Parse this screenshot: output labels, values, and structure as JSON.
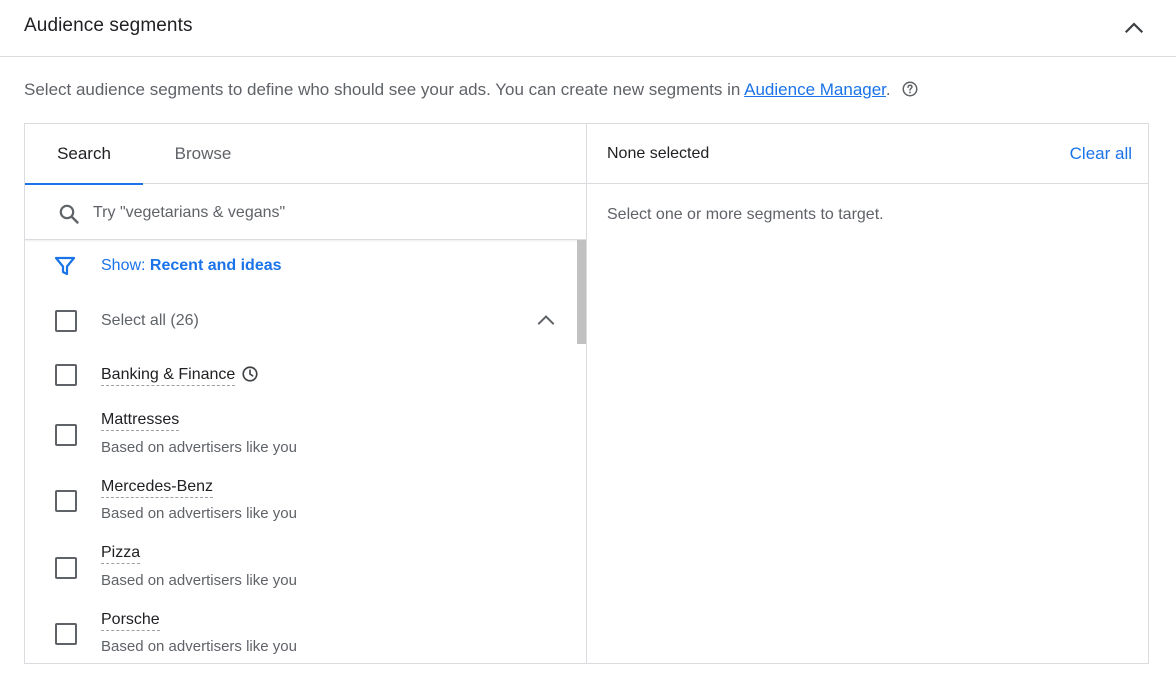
{
  "section": {
    "title": "Audience segments",
    "description_prefix": "Select audience segments to define who should see your ads. You can create new segments in ",
    "description_link": "Audience Manager",
    "description_suffix": "."
  },
  "tabs": [
    {
      "label": "Search",
      "active": true
    },
    {
      "label": "Browse",
      "active": false
    }
  ],
  "search": {
    "placeholder": "Try \"vegetarians & vegans\"",
    "value": ""
  },
  "filter": {
    "prefix": "Show: ",
    "value": "Recent and ideas"
  },
  "select_all": {
    "label": "Select all (26)"
  },
  "items": [
    {
      "label": "Banking & Finance",
      "sub": "",
      "recent": true
    },
    {
      "label": "Mattresses",
      "sub": "Based on advertisers like you",
      "recent": false
    },
    {
      "label": "Mercedes-Benz",
      "sub": "Based on advertisers like you",
      "recent": false
    },
    {
      "label": "Pizza",
      "sub": "Based on advertisers like you",
      "recent": false
    },
    {
      "label": "Porsche",
      "sub": "Based on advertisers like you",
      "recent": false
    }
  ],
  "selection": {
    "status": "None selected",
    "clear_label": "Clear all",
    "empty_message": "Select one or more segments to target."
  },
  "colors": {
    "accent": "#1a73e8",
    "border": "#dadce0",
    "text_primary": "#202124",
    "text_secondary": "#5f6368"
  },
  "icons": {
    "collapse": "chevron-up-icon",
    "help": "help-circle-icon",
    "search": "search-icon",
    "filter": "filter-icon",
    "recent": "clock-icon"
  }
}
